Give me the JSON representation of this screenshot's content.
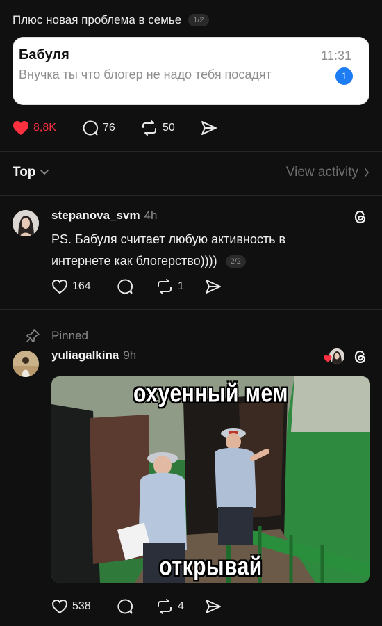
{
  "top_post": {
    "text": "Плюс новая проблема в семье",
    "counter": "1/2",
    "notification": {
      "sender": "Бабуля",
      "time": "11:31",
      "message": "Внучка ты что блогер не надо тебя посадят",
      "badge": "1"
    },
    "actions": {
      "likes": "8,8K",
      "comments": "76",
      "reposts": "50"
    },
    "like_color": "#ff3040"
  },
  "filter_bar": {
    "sort_label": "Top",
    "view_activity": "View activity"
  },
  "reply1": {
    "username": "stepanova_svm",
    "time": "4h",
    "text_line1": "PS. Бабуля считает любую активность в",
    "text_line2": "интернете как блогерство))))",
    "counter": "2/2",
    "actions": {
      "likes": "164",
      "reposts": "1"
    }
  },
  "reply2": {
    "pinned_label": "Pinned",
    "username": "yuliagalkina",
    "time": "9h",
    "meme_top": "охуенный мем",
    "meme_bottom": "открывай",
    "actions": {
      "likes": "538",
      "reposts": "4"
    }
  },
  "colors": {
    "background": "#101010",
    "accent_blue": "#1d7cf2",
    "like_red": "#ff3040"
  }
}
